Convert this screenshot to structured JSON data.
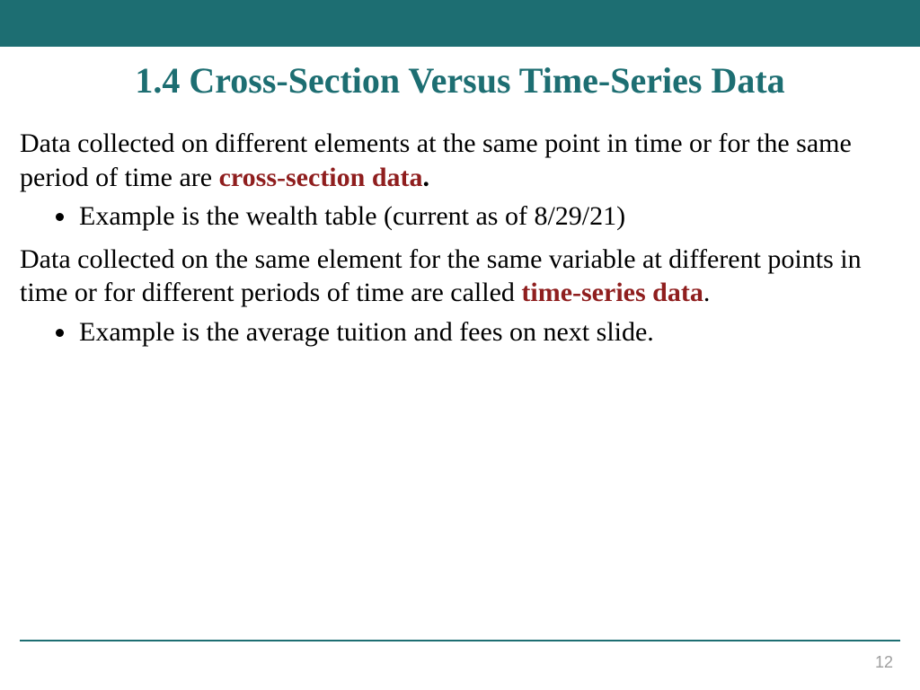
{
  "title": "1.4 Cross-Section Versus Time-Series Data",
  "para1_lead": "Data collected on different elements at the same point in time or for the same period of time are ",
  "para1_term": "cross-section data",
  "para1_tail": ".",
  "bullet1": "Example is the wealth table (current as of 8/29/21)",
  "para2_lead": "Data collected on the same element for the same variable at different points in time or for different periods of time are called ",
  "para2_term": "time-series data",
  "para2_tail": ".",
  "bullet2": "Example is the average tuition and fees on next slide.",
  "page_number": "12"
}
